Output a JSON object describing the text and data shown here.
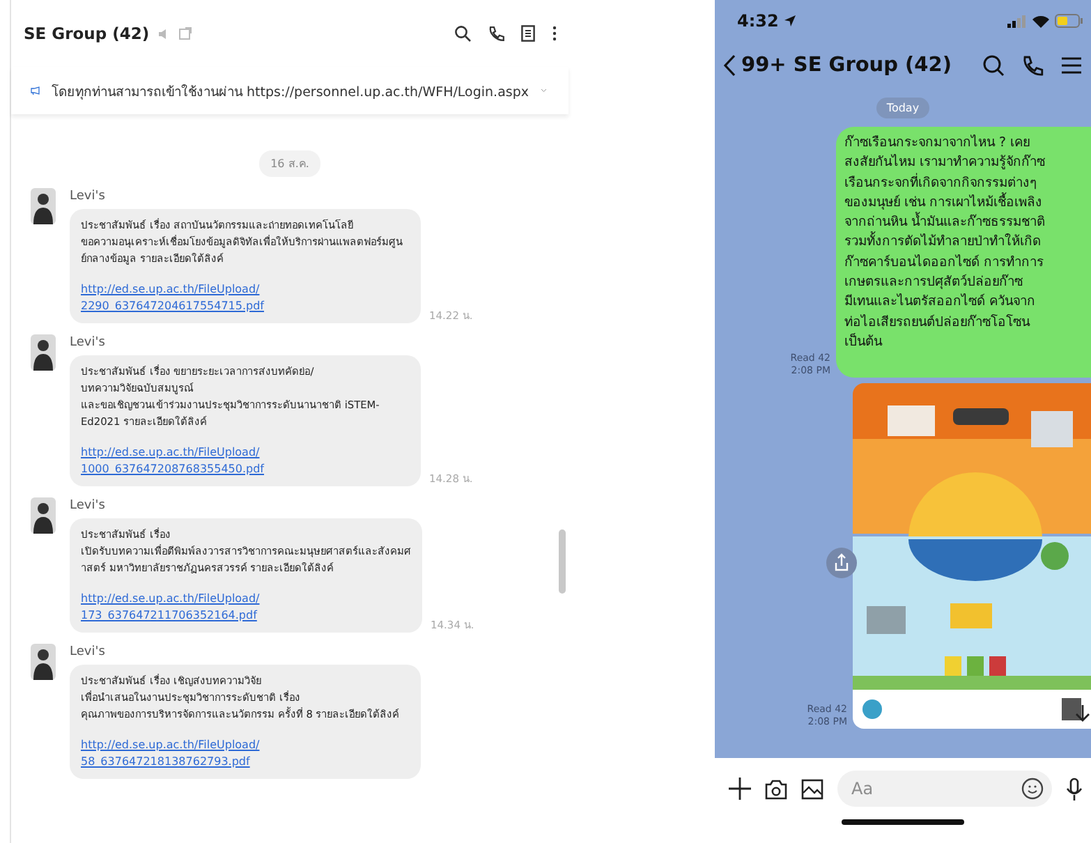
{
  "chat_desktop": {
    "title": "SE Group (42)",
    "announcement": "โดยทุกท่านสามารถเข้าใช้งานผ่าน https://personnel.up.ac.th/WFH/Login.aspx",
    "date": "16 ส.ค.",
    "messages": [
      {
        "sender": "Levi's",
        "text": "ประชาสัมพันธ์ เรื่อง สถาบันนวัตกรรมและถ่ายทอดเทคโนโลยี\nขอความอนุเคราะห์เชื่อมโยงข้อมูลดิจิทัลเพื่อให้บริการผ่านแพลตฟอร์มศูน\nย์กลางข้อมูล รายละเอียดใต้ลิงค์",
        "link": [
          "http://ed.se.up.ac.th/FileUpload/",
          "2290_637647204617554715.pdf"
        ],
        "time": "14.22 น."
      },
      {
        "sender": "Levi's",
        "text": "ประชาสัมพันธ์ เรื่อง ขยายระยะเวลาการส่งบทคัดย่อ/\nบทความวิจัยฉบับสมบูรณ์\nและขอเชิญชวนเข้าร่วมงานประชุมวิชาการระดับนานาชาติ iSTEM-\nEd2021 รายละเอียดใต้ลิงค์",
        "link": [
          "http://ed.se.up.ac.th/FileUpload/",
          "1000_637647208768355450.pdf"
        ],
        "time": "14.28 น."
      },
      {
        "sender": "Levi's",
        "text": "ประชาสัมพันธ์ เรื่อง\nเปิดรับบทความเพื่อตีพิมพ์ลงวารสารวิชาการคณะมนุษยศาสตร์และสังคมศ\nาสตร์ มหาวิทยาลัยราชภัฏนครสวรรค์ รายละเอียดใต้ลิงค์",
        "link": [
          "http://ed.se.up.ac.th/FileUpload/",
          "173_637647211706352164.pdf"
        ],
        "time": "14.34 น."
      },
      {
        "sender": "Levi's",
        "text": "ประชาสัมพันธ์ เรื่อง เชิญส่งบทความวิจัย\nเพื่อนำเสนอในงานประชุมวิชาการระดับชาติ เรื่อง\nคุณภาพของการบริหารจัดการและนวัตกรรม ครั้งที่ 8 รายละเอียดใต้ลิงค์",
        "link": [
          "http://ed.se.up.ac.th/FileUpload/",
          "58_637647218138762793.pdf"
        ]
      }
    ]
  },
  "chat_mobile": {
    "status_time": "4:32",
    "unread": "99+",
    "title": "SE Group (42)",
    "date": "Today",
    "messages": [
      {
        "kind": "text",
        "text": "ก๊าซเรือนกระจกมาจากไหน ? เคย\nสงสัยกันไหม เรามาทำความรู้จักก๊าซ\nเรือนกระจกที่เกิดจากกิจกรรมต่างๆ\nของมนุษย์ เช่น การเผาไหม้เชื้อเพลิง\nจากถ่านหิน น้ำมันและก๊าซธรรมชาติ\nรวมทั้งการตัดไม้ทำลายป่าทำให้เกิด\nก๊าซคาร์บอนไดออกไซด์ การทำการ\nเกษตรและการปศุสัตว์ปล่อยก๊าซ\nมีเทนและไนตรัสออกไซด์ ควันจาก\nท่อไอเสียรถยนต์ปล่อยก๊าซโอโซน\nเป็นต้น",
        "read": "Read 42",
        "time": "2:08 PM"
      },
      {
        "kind": "picture",
        "read": "Read 42",
        "time": "2:08 PM"
      }
    ],
    "input": {
      "placeholder": "Aa"
    }
  }
}
